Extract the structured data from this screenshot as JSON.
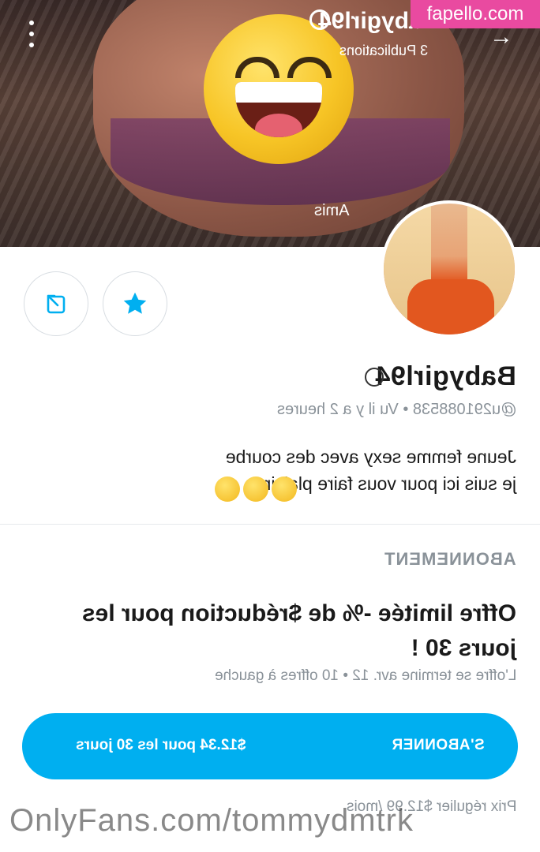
{
  "cover": {
    "name": "Babygirl94",
    "publications": "3 Publications",
    "amis_label": "Amis",
    "watermark": "fapello.com"
  },
  "profile": {
    "display_name": "Babygirl94",
    "handle_line": "@u291088538 • Vu il y a 2 heures",
    "bio": "Jeune femme sexy avec des courbe je suis ici pour vous faire plaisir"
  },
  "subscription": {
    "section_label": "ABONNEMENT",
    "offer_title": "Offre limitée -% de $réduction pour les jours 30 !",
    "offer_meta": "L'offre se termine avr. 12 • 10 offres à gauche",
    "button_label": "S'ABONNER",
    "button_price": "$12.34 pour les 30 jours",
    "regular_price": "Prix régulier $12.99 /mois"
  },
  "watermark_bottom": "OnlyFans.com/tommydmtrk",
  "colors": {
    "accent": "#00aff0",
    "watermark_pink": "#e94aa0",
    "muted_text": "#8a9299"
  },
  "icons": [
    "menu-dots-icon",
    "back-arrow-icon",
    "verified-badge-icon",
    "share-icon",
    "star-icon"
  ]
}
